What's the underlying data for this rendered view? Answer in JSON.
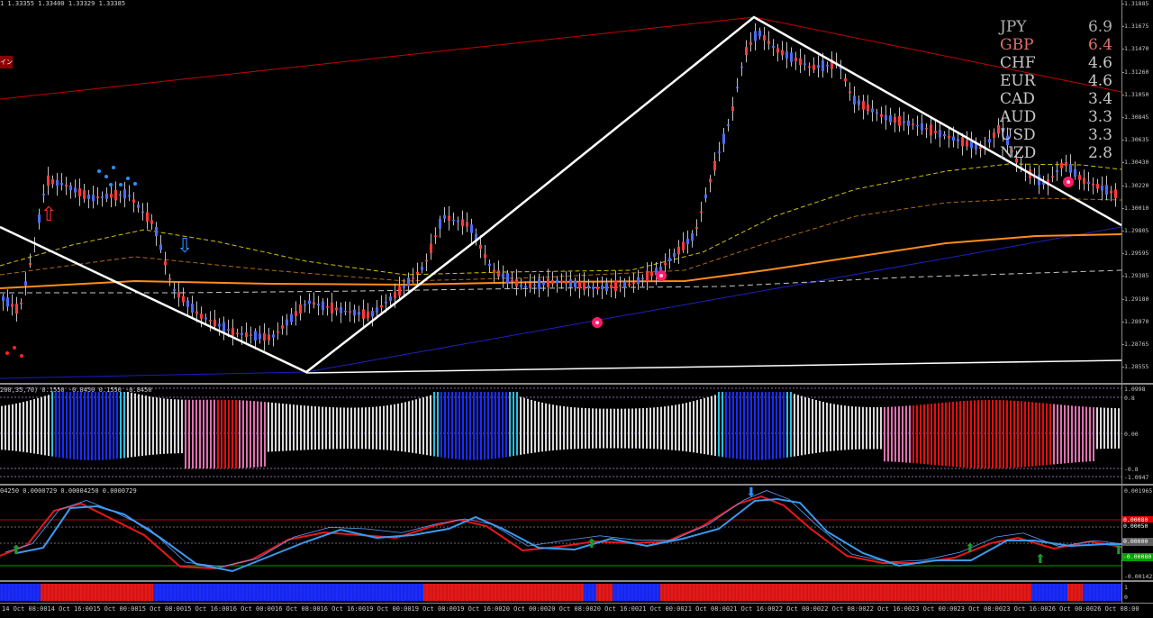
{
  "main_chart": {
    "ohlc_header": "1  1.33355 1.33400 1.33329 1.33385",
    "badge": "イン",
    "price_ticks": [
      "1.31885",
      "1.31675",
      "1.31470",
      "1.31260",
      "1.31050",
      "1.30845",
      "1.30635",
      "1.30430",
      "1.30220",
      "1.30010",
      "1.29805",
      "1.29595",
      "1.29385",
      "1.29180",
      "1.28970",
      "1.28765",
      "1.28555"
    ]
  },
  "currency_strength": [
    {
      "ccy": "JPY",
      "val": "6.9",
      "color": "#b0b0b0"
    },
    {
      "ccy": "GBP",
      "val": "6.4",
      "color": "#e07070"
    },
    {
      "ccy": "CHF",
      "val": "4.6",
      "color": "#c8c8c8"
    },
    {
      "ccy": "EUR",
      "val": "4.6",
      "color": "#c8c8c8"
    },
    {
      "ccy": "CAD",
      "val": "3.4",
      "color": "#c8c8c8"
    },
    {
      "ccy": "AUD",
      "val": "3.3",
      "color": "#c8c8c8"
    },
    {
      "ccy": "USD",
      "val": "3.3",
      "color": "#c8c8c8"
    },
    {
      "ccy": "NZD",
      "val": "2.8",
      "color": "#c8c8c8"
    }
  ],
  "indicator1": {
    "header": "200,35,70) 0.1550 -0.8450 0.1550 -0.8450",
    "ticks": [
      "1.0998",
      "0.8",
      "0.00",
      "-0.8",
      "-1.0947"
    ]
  },
  "indicator2": {
    "header": "04250 0.0000729 0.00004250 0.0000729",
    "ticks": [
      "0.001965",
      "-0.001422"
    ],
    "price_boxes": [
      {
        "text": "0.00080",
        "color": "#e00000"
      },
      {
        "text": "0.00050",
        "color": "#000000"
      },
      {
        "text": "0.00000",
        "color": "#606060"
      },
      {
        "text": "-0.00080",
        "color": "#00a000"
      }
    ]
  },
  "indicator3": {
    "ticks": [
      "1",
      "0"
    ]
  },
  "time_axis": [
    "14 Oct 08:00",
    "14 Oct 16:00",
    "15 Oct 00:00",
    "15 Oct 08:00",
    "15 Oct 16:00",
    "16 Oct 00:00",
    "16 Oct 08:00",
    "16 Oct 16:00",
    "19 Oct 00:00",
    "19 Oct 08:00",
    "19 Oct 16:00",
    "20 Oct 00:00",
    "20 Oct 08:00",
    "20 Oct 16:00",
    "21 Oct 00:00",
    "21 Oct 08:00",
    "21 Oct 16:00",
    "22 Oct 00:00",
    "22 Oct 08:00",
    "22 Oct 16:00",
    "23 Oct 00:00",
    "23 Oct 08:00",
    "23 Oct 16:00",
    "26 Oct 00:00",
    "26 Oct 08:00"
  ],
  "colors": {
    "bull": "#4a6cff",
    "bear": "#ff3a3a",
    "zigzag": "#ffffff",
    "ema_orange": "#ff8c1a",
    "ema_yellow": "#d4c000",
    "trend_blue": "#1a1aff",
    "trend_red": "#c80000"
  }
}
